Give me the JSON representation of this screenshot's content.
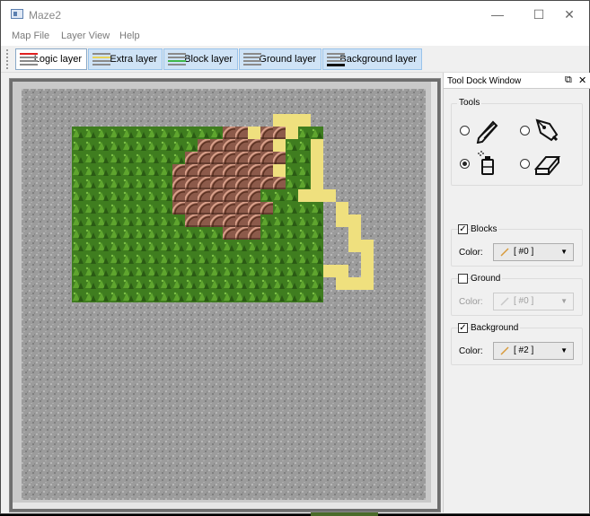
{
  "window": {
    "title": "Maze2",
    "controls": [
      "minimize",
      "maximize",
      "close"
    ]
  },
  "menubar": {
    "items": [
      "Map File",
      "Layer View",
      "Help"
    ]
  },
  "toolbar": {
    "layers": [
      {
        "label": "Logic layer",
        "stripe": "#e02020",
        "active": true
      },
      {
        "label": "Extra layer",
        "stripe": "#e8d35a",
        "active": false
      },
      {
        "label": "Block layer",
        "stripe": "#3fb84a",
        "active": false
      },
      {
        "label": "Ground layer",
        "stripe": "#8a8a8a",
        "active": false
      },
      {
        "label": "Background layer",
        "stripe": "#111111",
        "active": false
      }
    ]
  },
  "map": {
    "cols": 32,
    "rows": 32,
    "tile_types": {
      "0": "stone-background",
      "1": "green-ground",
      "2": "brown-block",
      "3": "yellow-logic-path"
    },
    "colors": {
      "stone": "#9c9c9c",
      "green": "#3f7d1f",
      "brown": "#8c5a4a",
      "yellow": "#efe07e"
    },
    "tiles": [
      "00000000000000000000000000000000",
      "00000000000000000000000000000000",
      "00000000000000000000333000000000",
      "00001111111111112232231100000000",
      "00001111111111222222311300000000",
      "00001111111112222222211300000000",
      "00001111111122222222311300000000",
      "00001111111122222222211300000000",
      "00001111111122222221113330000000",
      "00001111111122222222111103000000",
      "00001111111112222221111103300000",
      "00001111111111112221111100300000",
      "00001111111111111111111100330000",
      "00001111111111111111111100030000",
      "00001111111111111111111133030000",
      "00001111111111111111111103330000",
      "00001111111111111111111100000000",
      "00000000000000000000000000000000",
      "00000000000000000000000000000000",
      "00000000000000000000000000000000",
      "00000000000000000000000000000000",
      "00000000000000000000000000000000",
      "00000000000000000000000000000000",
      "00000000000000000000000000000000",
      "00000000000000000000000000000000",
      "00000000000000000000000000000000",
      "00000000000000000000000000000000",
      "00000000000000000000000000000000",
      "00000000000000000000000000000000",
      "00000000000000000000000000000000",
      "00000000000000000000000000000000",
      "00000000000000000000000000000000"
    ]
  },
  "dock": {
    "title": "Tool Dock Window",
    "tools_group": "Tools",
    "tools": [
      {
        "icon": "pencil-icon",
        "selected": false
      },
      {
        "icon": "pen-nib-icon",
        "selected": false
      },
      {
        "icon": "spray-can-icon",
        "selected": true
      },
      {
        "icon": "eraser-icon",
        "selected": false
      }
    ],
    "blocks": {
      "label": "Blocks",
      "checked": true,
      "color_label": "Color:",
      "color_value": "[ #0 ]",
      "enabled": true
    },
    "ground": {
      "label": "Ground",
      "checked": false,
      "color_label": "Color:",
      "color_value": "[ #0 ]",
      "enabled": false
    },
    "background": {
      "label": "Background",
      "checked": true,
      "color_label": "Color:",
      "color_value": "[ #2 ]",
      "enabled": true
    }
  }
}
